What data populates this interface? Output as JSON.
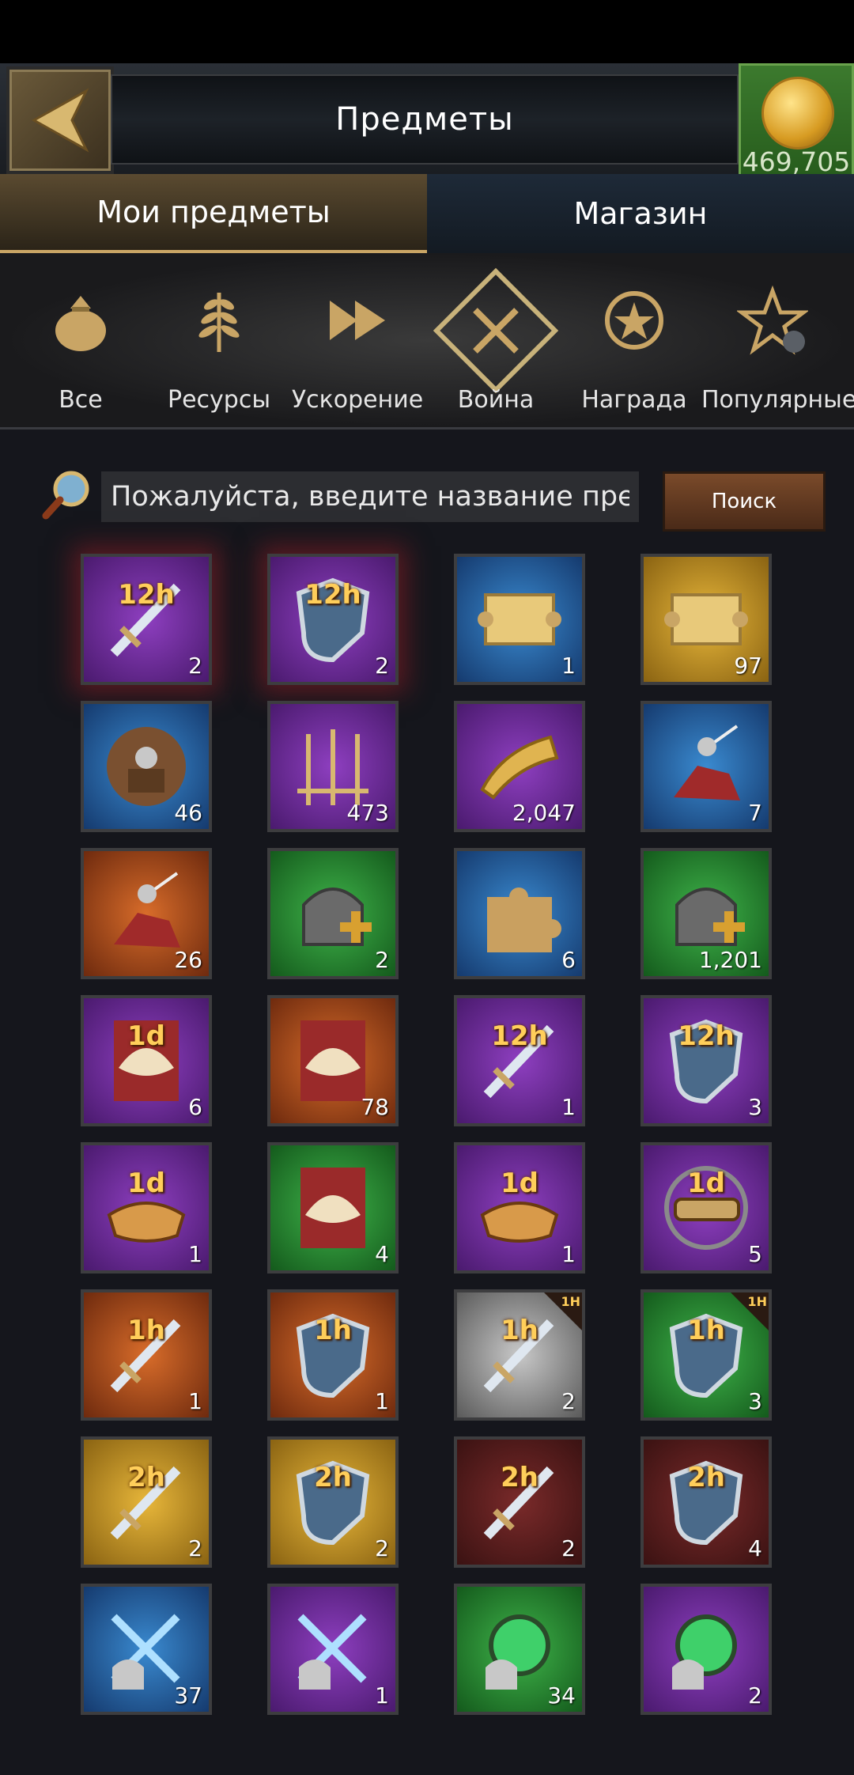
{
  "header": {
    "title": "Предметы",
    "gold_amount": "469,705"
  },
  "tabs": [
    {
      "label": "Мои предметы",
      "active": true
    },
    {
      "label": "Магазин",
      "active": false
    }
  ],
  "categories": [
    {
      "label": "Все",
      "icon": "bag-icon"
    },
    {
      "label": "Ресурсы",
      "icon": "wheat-icon"
    },
    {
      "label": "Ускорение",
      "icon": "fast-forward-icon"
    },
    {
      "label": "Война",
      "icon": "crossed-swords-icon",
      "active": true
    },
    {
      "label": "Награда",
      "icon": "star-badge-icon"
    },
    {
      "label": "Популярные",
      "icon": "star-icon"
    }
  ],
  "search": {
    "placeholder": "Пожалуйста, введите название предмета",
    "button_label": "Поиск"
  },
  "items": [
    {
      "icon": "sword-icon",
      "bg": "purple",
      "timer": "12h",
      "count": "2",
      "glow": true
    },
    {
      "icon": "shield-icon",
      "bg": "purple",
      "timer": "12h",
      "count": "2",
      "glow": true
    },
    {
      "icon": "scroll-icon",
      "bg": "blue",
      "count": "1"
    },
    {
      "icon": "scroll-icon",
      "bg": "gold",
      "count": "97"
    },
    {
      "icon": "cavalry-icon",
      "bg": "blue",
      "count": "46"
    },
    {
      "icon": "spears-icon",
      "bg": "purple",
      "count": "473"
    },
    {
      "icon": "horn-icon",
      "bg": "purple",
      "count": "2,047"
    },
    {
      "icon": "knight-icon",
      "bg": "blue",
      "count": "7"
    },
    {
      "icon": "knight-icon",
      "bg": "orange",
      "count": "26"
    },
    {
      "icon": "helmet-plus-icon",
      "bg": "green",
      "count": "2"
    },
    {
      "icon": "puzzle-icon",
      "bg": "blue",
      "count": "6"
    },
    {
      "icon": "helmet-plus-icon",
      "bg": "green",
      "count": "1,201"
    },
    {
      "icon": "dove-icon",
      "bg": "purple",
      "timer": "1d",
      "count": "6"
    },
    {
      "icon": "dove-icon",
      "bg": "orange",
      "count": "78"
    },
    {
      "icon": "sword-icon",
      "bg": "purple",
      "timer": "12h",
      "count": "1"
    },
    {
      "icon": "shield-icon",
      "bg": "purple",
      "timer": "12h",
      "count": "3"
    },
    {
      "icon": "bread-icon",
      "bg": "purple",
      "timer": "1d",
      "count": "1"
    },
    {
      "icon": "dove-icon",
      "bg": "green",
      "count": "4"
    },
    {
      "icon": "bread-icon",
      "bg": "purple",
      "timer": "1d",
      "count": "1"
    },
    {
      "icon": "spyglass-icon",
      "bg": "purple",
      "timer": "1d",
      "count": "5"
    },
    {
      "icon": "sword-icon",
      "bg": "orange",
      "timer": "1h",
      "count": "1"
    },
    {
      "icon": "shield-icon",
      "bg": "orange",
      "timer": "1h",
      "count": "1"
    },
    {
      "icon": "sword-icon",
      "bg": "gray",
      "timer": "1h",
      "count": "2",
      "corner": "1H"
    },
    {
      "icon": "shield-icon",
      "bg": "green",
      "timer": "1h",
      "count": "3",
      "corner": "1H"
    },
    {
      "icon": "sword-icon",
      "bg": "gold",
      "timer": "2h",
      "count": "2"
    },
    {
      "icon": "shield-icon",
      "bg": "gold",
      "timer": "2h",
      "count": "2"
    },
    {
      "icon": "sword-icon",
      "bg": "red",
      "timer": "2h",
      "count": "2"
    },
    {
      "icon": "shield-icon",
      "bg": "red",
      "timer": "2h",
      "count": "4"
    },
    {
      "icon": "helmet-blades-icon",
      "bg": "blue",
      "count": "37"
    },
    {
      "icon": "helmet-blades-icon",
      "bg": "purple",
      "count": "1"
    },
    {
      "icon": "helmet-orb-icon",
      "bg": "green",
      "count": "34"
    },
    {
      "icon": "helmet-orb-icon",
      "bg": "purple",
      "count": "2"
    }
  ],
  "colors": {
    "accent_gold": "#c9a565",
    "timer_text": "#ffce5a",
    "coin_green": "#3c7a2e"
  }
}
